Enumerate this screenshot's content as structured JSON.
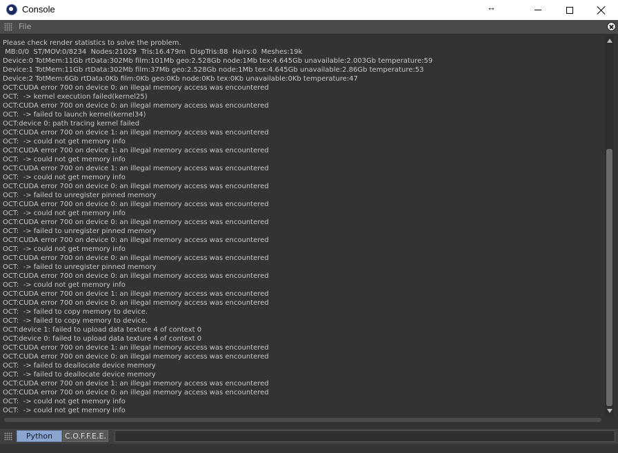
{
  "window": {
    "title": "Console",
    "resize_glyph": "↔"
  },
  "menubar": {
    "file_label": "File"
  },
  "log": [
    "Please check render statistics to solve the problem.",
    " MB:0/0  ST/MOV:0/8234  Nodes:21029  Tris:16.479m  DispTris:88  Hairs:0  Meshes:19k",
    "Device:0 TotMem:11Gb rtData:302Mb film:101Mb geo:2.528Gb node:1Mb tex:4.645Gb unavailable:2.003Gb temperature:59",
    "Device:1 TotMem:11Gb rtData:302Mb film:37Mb geo:2.528Gb node:1Mb tex:4.645Gb unavailable:2.86Gb temperature:53",
    "Device:2 TotMem:6Gb rtData:0Kb film:0Kb geo:0Kb node:0Kb tex:0Kb unavailable:0Kb temperature:47",
    "OCT:CUDA error 700 on device 0: an illegal memory access was encountered",
    "OCT:  -> kernel execution failed(kernel25)",
    "OCT:CUDA error 700 on device 0: an illegal memory access was encountered",
    "OCT:  -> failed to launch kernel(kernel34)",
    "OCT:device 0: path tracing kernel failed",
    "OCT:CUDA error 700 on device 1: an illegal memory access was encountered",
    "OCT:  -> could not get memory info",
    "OCT:CUDA error 700 on device 1: an illegal memory access was encountered",
    "OCT:  -> could not get memory info",
    "OCT:CUDA error 700 on device 1: an illegal memory access was encountered",
    "OCT:  -> could not get memory info",
    "OCT:CUDA error 700 on device 0: an illegal memory access was encountered",
    "OCT:  -> failed to unregister pinned memory",
    "OCT:CUDA error 700 on device 0: an illegal memory access was encountered",
    "OCT:  -> could not get memory info",
    "OCT:CUDA error 700 on device 0: an illegal memory access was encountered",
    "OCT:  -> failed to unregister pinned memory",
    "OCT:CUDA error 700 on device 0: an illegal memory access was encountered",
    "OCT:  -> could not get memory info",
    "OCT:CUDA error 700 on device 0: an illegal memory access was encountered",
    "OCT:  -> failed to unregister pinned memory",
    "OCT:CUDA error 700 on device 0: an illegal memory access was encountered",
    "OCT:  -> could not get memory info",
    "OCT:CUDA error 700 on device 1: an illegal memory access was encountered",
    "OCT:CUDA error 700 on device 0: an illegal memory access was encountered",
    "OCT:  -> failed to copy memory to device.",
    "OCT:  -> failed to copy memory to device.",
    "OCT:device 1: failed to upload data texture 4 of context 0",
    "OCT:device 0: failed to upload data texture 4 of context 0",
    "OCT:CUDA error 700 on device 1: an illegal memory access was encountered",
    "OCT:CUDA error 700 on device 0: an illegal memory access was encountered",
    "OCT:  -> failed to deallocate device memory",
    "OCT:  -> failed to deallocate device memory",
    "OCT:CUDA error 700 on device 1: an illegal memory access was encountered",
    "OCT:CUDA error 700 on device 0: an illegal memory access was encountered",
    "OCT:  -> could not get memory info",
    "OCT:  -> could not get memory info"
  ],
  "bottombar": {
    "tabs": [
      {
        "label": "Python",
        "active": true
      },
      {
        "label": "C.O.F.F.E.E.",
        "active": false
      }
    ],
    "command_value": ""
  },
  "icons": {
    "app": "cinema4d-app-icon",
    "grip": "grip-dots-icon",
    "panel_close": "close-circle-icon"
  },
  "colors": {
    "background": "#333333",
    "text": "#c9c9c9",
    "active_tab": "#8aa5cf"
  }
}
